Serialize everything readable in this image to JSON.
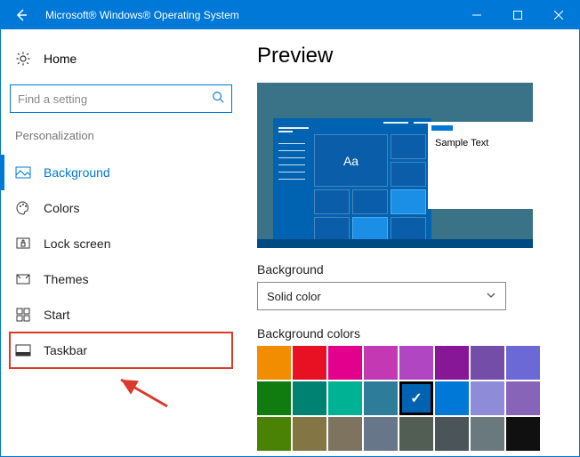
{
  "titlebar": {
    "title": "Microsoft® Windows® Operating System"
  },
  "sidebar": {
    "home": "Home",
    "search_placeholder": "Find a setting",
    "section": "Personalization",
    "items": [
      {
        "label": "Background"
      },
      {
        "label": "Colors"
      },
      {
        "label": "Lock screen"
      },
      {
        "label": "Themes"
      },
      {
        "label": "Start"
      },
      {
        "label": "Taskbar"
      }
    ]
  },
  "main": {
    "heading": "Preview",
    "sample_text": "Sample Text",
    "tile_text": "Aa",
    "bg_label": "Background",
    "bg_select_value": "Solid color",
    "colors_label": "Background colors",
    "swatches": [
      [
        "#f28c00",
        "#e81123",
        "#e3008c",
        "#c239b3",
        "#b146c2",
        "#881798",
        "#744da9",
        "#6b69d6"
      ],
      [
        "#107c10",
        "#008272",
        "#00b294",
        "#2d7d9a",
        "#0063b1",
        "#0078d7",
        "#8e8cd8",
        "#8764b8"
      ],
      [
        "#498205",
        "#847545",
        "#7e735f",
        "#68768a",
        "#525e54",
        "#4a5459",
        "#69797e",
        "#101010"
      ]
    ],
    "selected_swatch": [
      1,
      4
    ]
  }
}
